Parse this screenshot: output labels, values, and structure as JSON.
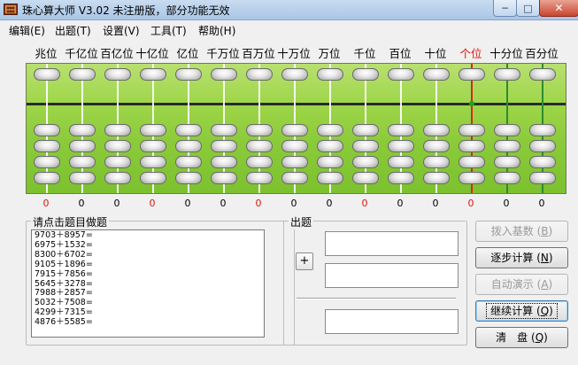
{
  "window": {
    "title": "珠心算大师 V3.02 未注册版，部分功能无效",
    "min_glyph": "─",
    "max_glyph": "□",
    "close_glyph": "✕",
    "icon": "abacus-app-icon"
  },
  "menu": [
    {
      "label": "编辑(E)"
    },
    {
      "label": "出题(T)"
    },
    {
      "label": "设置(V)"
    },
    {
      "label": "工具(T)"
    },
    {
      "label": "帮助(H)"
    }
  ],
  "positions": [
    {
      "label": "兆位",
      "digit": "0",
      "red": false,
      "digit_red": true
    },
    {
      "label": "千亿位",
      "digit": "0",
      "red": false,
      "digit_red": false
    },
    {
      "label": "百亿位",
      "digit": "0",
      "red": false,
      "digit_red": false
    },
    {
      "label": "十亿位",
      "digit": "0",
      "red": false,
      "digit_red": true
    },
    {
      "label": "亿位",
      "digit": "0",
      "red": false,
      "digit_red": false
    },
    {
      "label": "千万位",
      "digit": "0",
      "red": false,
      "digit_red": false
    },
    {
      "label": "百万位",
      "digit": "0",
      "red": false,
      "digit_red": true
    },
    {
      "label": "十万位",
      "digit": "0",
      "red": false,
      "digit_red": false
    },
    {
      "label": "万位",
      "digit": "0",
      "red": false,
      "digit_red": false
    },
    {
      "label": "千位",
      "digit": "0",
      "red": false,
      "digit_red": true
    },
    {
      "label": "百位",
      "digit": "0",
      "red": false,
      "digit_red": false
    },
    {
      "label": "十位",
      "digit": "0",
      "red": false,
      "digit_red": false
    },
    {
      "label": "个位",
      "digit": "0",
      "red": true,
      "digit_red": true
    },
    {
      "label": "十分位",
      "digit": "0",
      "red": false,
      "digit_red": false
    },
    {
      "label": "百分位",
      "digit": "0",
      "red": false,
      "digit_red": false
    }
  ],
  "problems_group": {
    "title": "请点击题目做题",
    "items": [
      "9703＋8957=",
      "6975＋1532=",
      "8300＋6702=",
      "9105＋1896=",
      "7915＋7856=",
      "5645＋3278=",
      "7988＋2857=",
      "5032＋7508=",
      "4299＋7315=",
      "4876＋5585="
    ]
  },
  "question_group": {
    "title": "出题",
    "plus_label": "+"
  },
  "buttons": [
    {
      "label": "拨入基数",
      "hotkey": "B",
      "disabled": true,
      "focus": false
    },
    {
      "label": "逐步计算",
      "hotkey": "N",
      "disabled": false,
      "focus": false
    },
    {
      "label": "自动演示",
      "hotkey": "A",
      "disabled": true,
      "focus": false
    },
    {
      "label": "继续计算",
      "hotkey": "Q",
      "disabled": false,
      "focus": true
    },
    {
      "label": "清　盘",
      "hotkey": "Q",
      "disabled": false,
      "focus": false
    }
  ],
  "colors": {
    "red_label": "#e0140e",
    "abacus_green": "#8bcb3a",
    "unit_rod": "#d32a1a"
  }
}
